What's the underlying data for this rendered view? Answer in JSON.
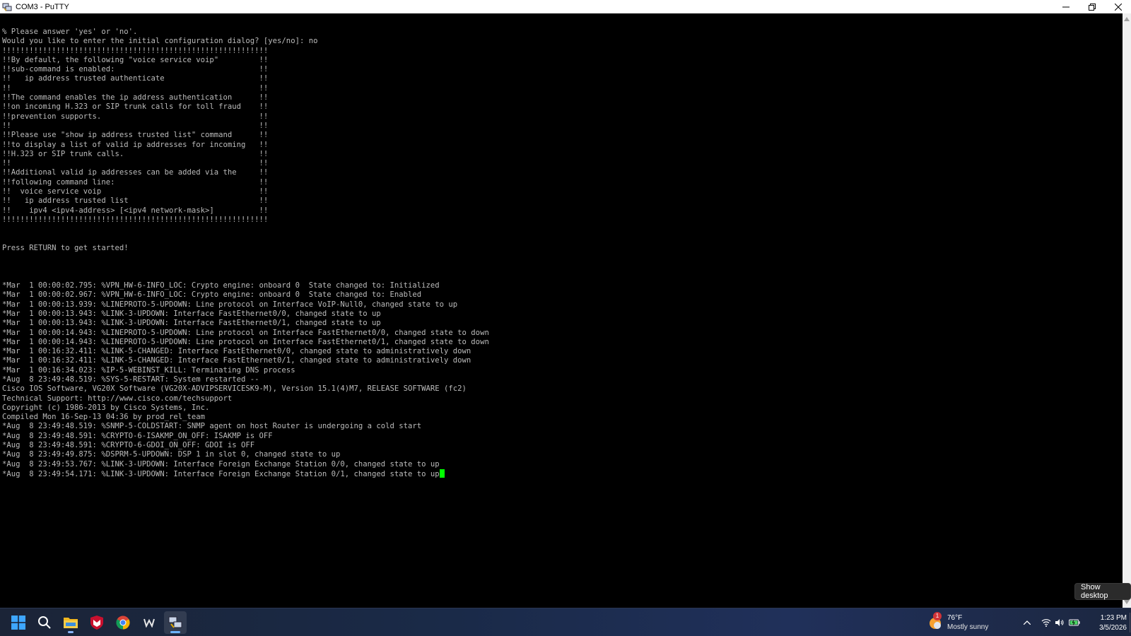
{
  "window": {
    "title": "COM3 - PuTTY",
    "controls": [
      "minimize-icon",
      "restore-icon",
      "close-icon"
    ]
  },
  "terminal": {
    "lines": [
      "% Please answer 'yes' or 'no'.",
      "Would you like to enter the initial configuration dialog? [yes/no]: no",
      "!!!!!!!!!!!!!!!!!!!!!!!!!!!!!!!!!!!!!!!!!!!!!!!!!!!!!!!!!!!",
      "!!By default, the following \"voice service voip\"         !!",
      "!!sub-command is enabled:                                !!",
      "!!   ip address trusted authenticate                     !!",
      "!!                                                       !!",
      "!!The command enables the ip address authentication      !!",
      "!!on incoming H.323 or SIP trunk calls for toll fraud    !!",
      "!!prevention supports.                                   !!",
      "!!                                                       !!",
      "!!Please use \"show ip address trusted list\" command      !!",
      "!!to display a list of valid ip addresses for incoming   !!",
      "!!H.323 or SIP trunk calls.                              !!",
      "!!                                                       !!",
      "!!Additional valid ip addresses can be added via the     !!",
      "!!following command line:                                !!",
      "!!  voice service voip                                   !!",
      "!!   ip address trusted list                             !!",
      "!!    ipv4 <ipv4-address> [<ipv4 network-mask>]          !!",
      "!!!!!!!!!!!!!!!!!!!!!!!!!!!!!!!!!!!!!!!!!!!!!!!!!!!!!!!!!!!",
      "",
      "",
      "Press RETURN to get started!",
      "",
      "",
      "",
      "*Mar  1 00:00:02.795: %VPN_HW-6-INFO_LOC: Crypto engine: onboard 0  State changed to: Initialized",
      "*Mar  1 00:00:02.967: %VPN_HW-6-INFO_LOC: Crypto engine: onboard 0  State changed to: Enabled",
      "*Mar  1 00:00:13.939: %LINEPROTO-5-UPDOWN: Line protocol on Interface VoIP-Null0, changed state to up",
      "*Mar  1 00:00:13.943: %LINK-3-UPDOWN: Interface FastEthernet0/0, changed state to up",
      "*Mar  1 00:00:13.943: %LINK-3-UPDOWN: Interface FastEthernet0/1, changed state to up",
      "*Mar  1 00:00:14.943: %LINEPROTO-5-UPDOWN: Line protocol on Interface FastEthernet0/0, changed state to down",
      "*Mar  1 00:00:14.943: %LINEPROTO-5-UPDOWN: Line protocol on Interface FastEthernet0/1, changed state to down",
      "*Mar  1 00:16:32.411: %LINK-5-CHANGED: Interface FastEthernet0/0, changed state to administratively down",
      "*Mar  1 00:16:32.411: %LINK-5-CHANGED: Interface FastEthernet0/1, changed state to administratively down",
      "*Mar  1 00:16:34.023: %IP-5-WEBINST_KILL: Terminating DNS process",
      "*Aug  8 23:49:48.519: %SYS-5-RESTART: System restarted --",
      "Cisco IOS Software, VG20X Software (VG20X-ADVIPSERVICESK9-M), Version 15.1(4)M7, RELEASE SOFTWARE (fc2)",
      "Technical Support: http://www.cisco.com/techsupport",
      "Copyright (c) 1986-2013 by Cisco Systems, Inc.",
      "Compiled Mon 16-Sep-13 04:36 by prod_rel_team",
      "*Aug  8 23:49:48.519: %SNMP-5-COLDSTART: SNMP agent on host Router is undergoing a cold start",
      "*Aug  8 23:49:48.591: %CRYPTO-6-ISAKMP_ON_OFF: ISAKMP is OFF",
      "*Aug  8 23:49:48.591: %CRYPTO-6-GDOI_ON_OFF: GDOI is OFF",
      "*Aug  8 23:49:49.875: %DSPRM-5-UPDOWN: DSP 1 in slot 0, changed state to up",
      "*Aug  8 23:49:53.767: %LINK-3-UPDOWN: Interface Foreign Exchange Station 0/0, changed state to up"
    ],
    "last_line": "*Aug  8 23:49:54.171: %LINK-3-UPDOWN: Interface Foreign Exchange Station 0/1, changed state to up",
    "cursor_color": "#00ff00"
  },
  "tooltip": {
    "text": "Show desktop"
  },
  "taskbar": {
    "apps": [
      {
        "name": "start-button",
        "icon": "windows-logo-icon"
      },
      {
        "name": "search-button",
        "icon": "search-icon"
      },
      {
        "name": "file-explorer",
        "icon": "folder-icon"
      },
      {
        "name": "mcafee",
        "icon": "mcafee-shield-icon"
      },
      {
        "name": "chrome",
        "icon": "chrome-icon"
      },
      {
        "name": "wiki-app",
        "icon": "w-letter-icon"
      },
      {
        "name": "putty",
        "icon": "putty-icon"
      }
    ],
    "weather": {
      "badge": "1",
      "temp": "76°F",
      "condition": "Mostly sunny"
    },
    "clock": {
      "time": "1:23 PM",
      "date": "3/5/2026"
    }
  },
  "colors": {
    "terminal_bg": "#000000",
    "terminal_fg": "#bbbbbb",
    "taskbar_bg": "#1c2740",
    "accent": "#6cb4ff"
  }
}
